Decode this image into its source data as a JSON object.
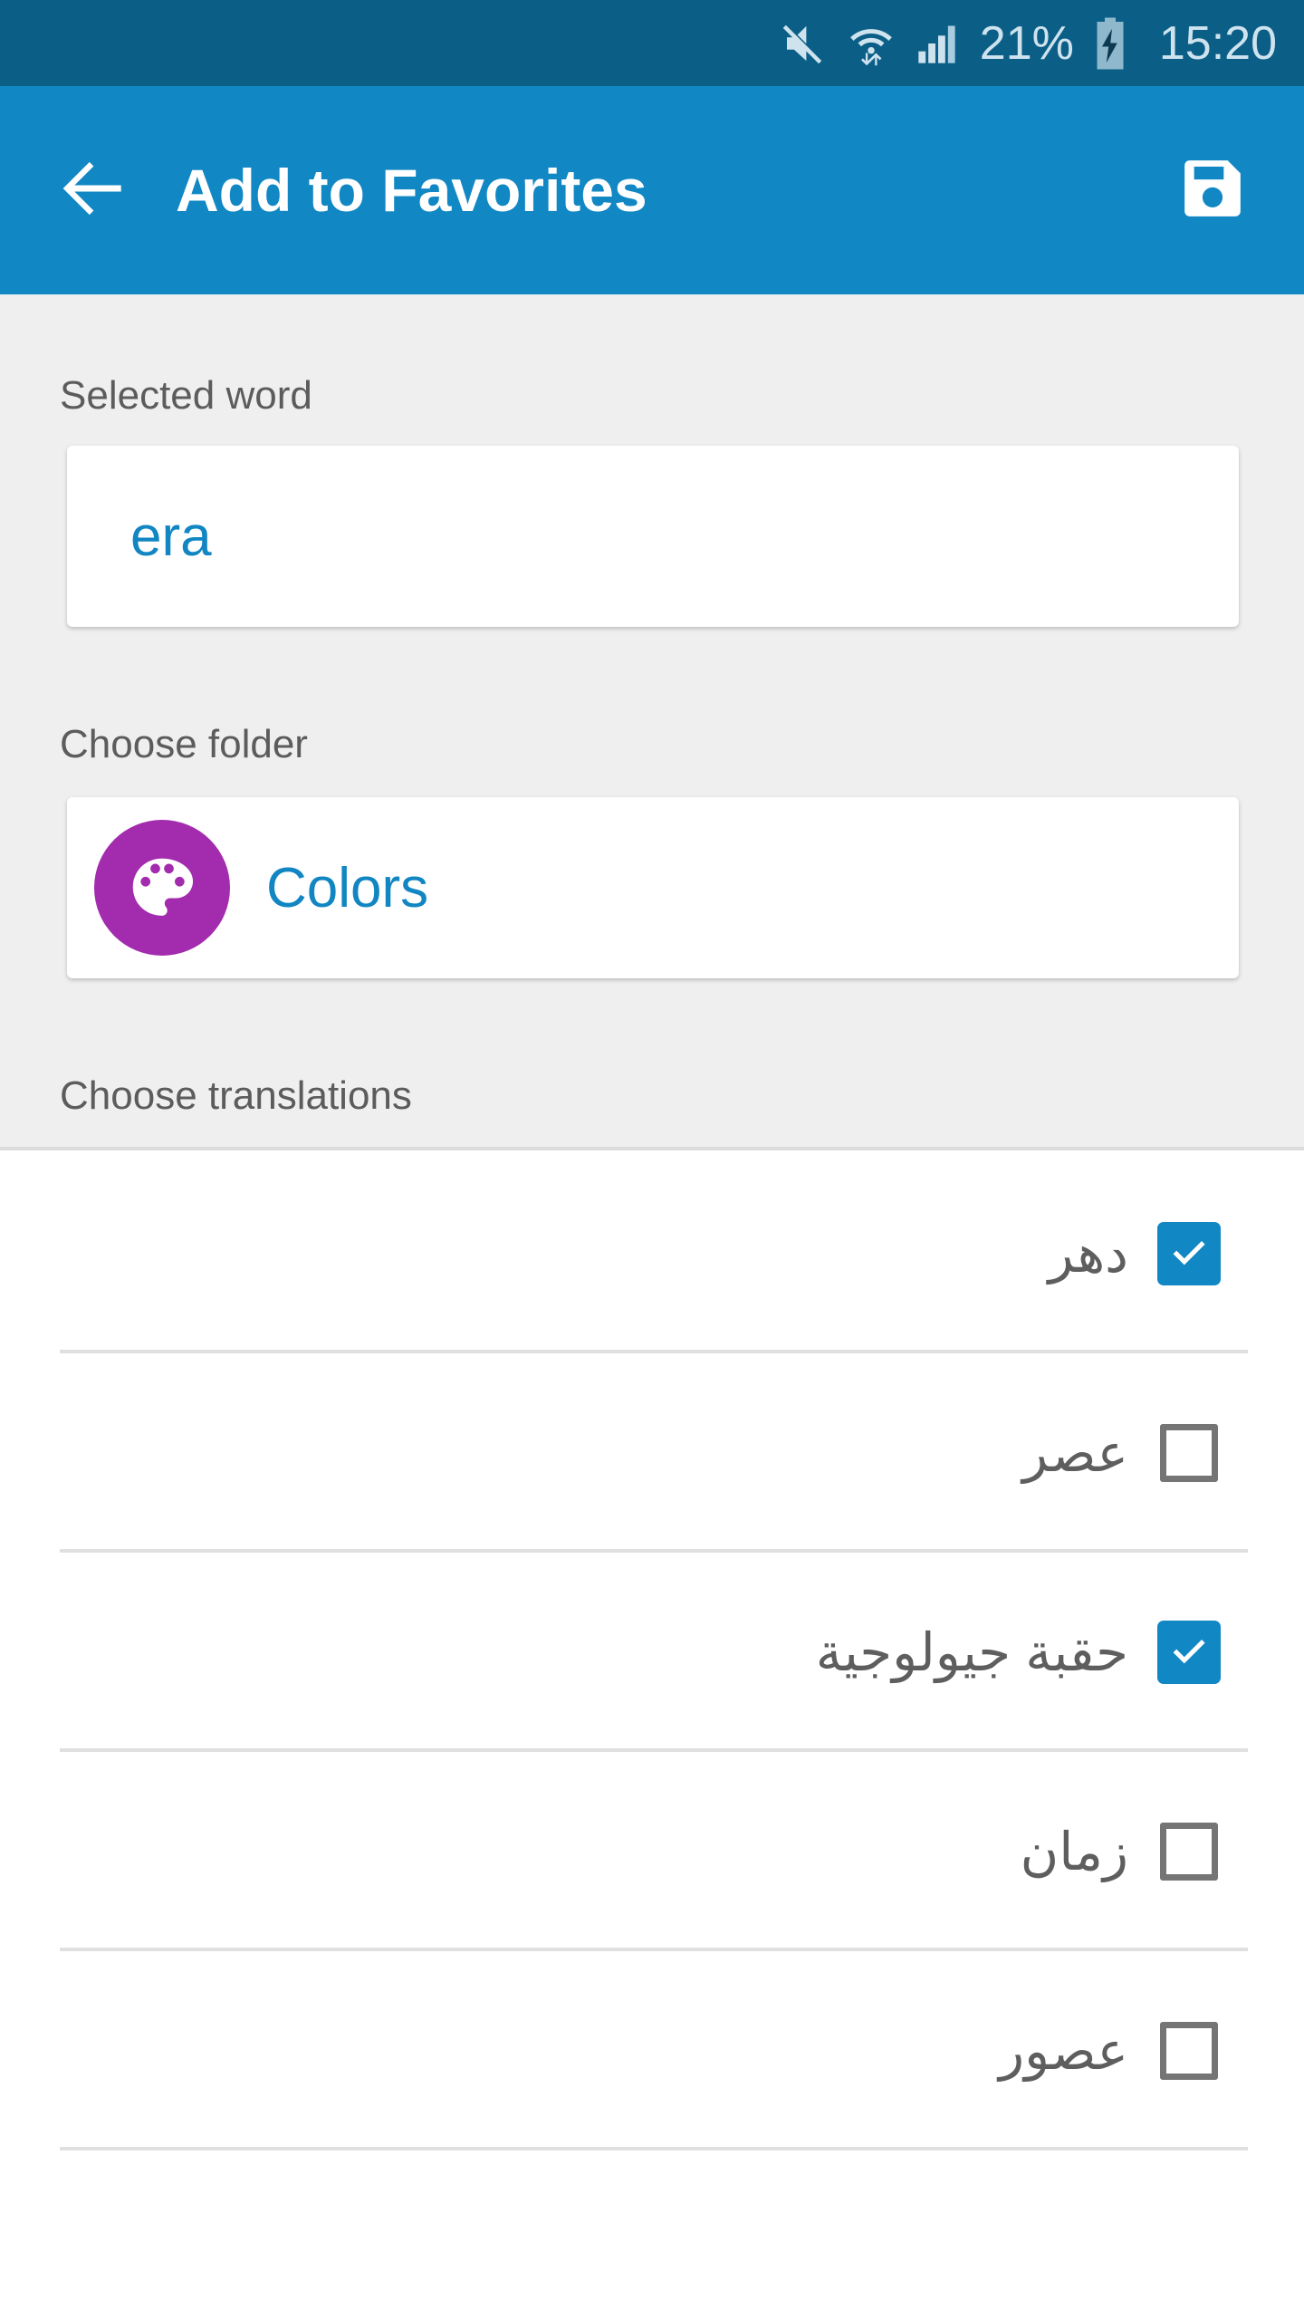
{
  "status_bar": {
    "battery_percent": "21%",
    "time": "15:20",
    "icons": [
      "mute-icon",
      "wifi-icon",
      "signal-icon",
      "battery-charging-icon"
    ],
    "background_color": "#0b5f87",
    "text_color": "#cfe3ef"
  },
  "app_bar": {
    "title": "Add to Favorites",
    "back_icon": "arrow-left-icon",
    "save_icon": "save-floppy-icon",
    "background_color": "#1187c4"
  },
  "form": {
    "selected_word_label": "Selected word",
    "selected_word_value": "era",
    "choose_folder_label": "Choose folder",
    "folder_name": "Colors",
    "folder_icon": "palette-icon",
    "folder_icon_color": "#a32bae",
    "accent_color": "#1186c2",
    "choose_translations_label": "Choose translations"
  },
  "translations": [
    {
      "text": "دهر",
      "checked": true
    },
    {
      "text": "عصر",
      "checked": false
    },
    {
      "text": "حقبة جيولوجية",
      "checked": true
    },
    {
      "text": "زمان",
      "checked": false
    },
    {
      "text": "عصور",
      "checked": false
    }
  ]
}
